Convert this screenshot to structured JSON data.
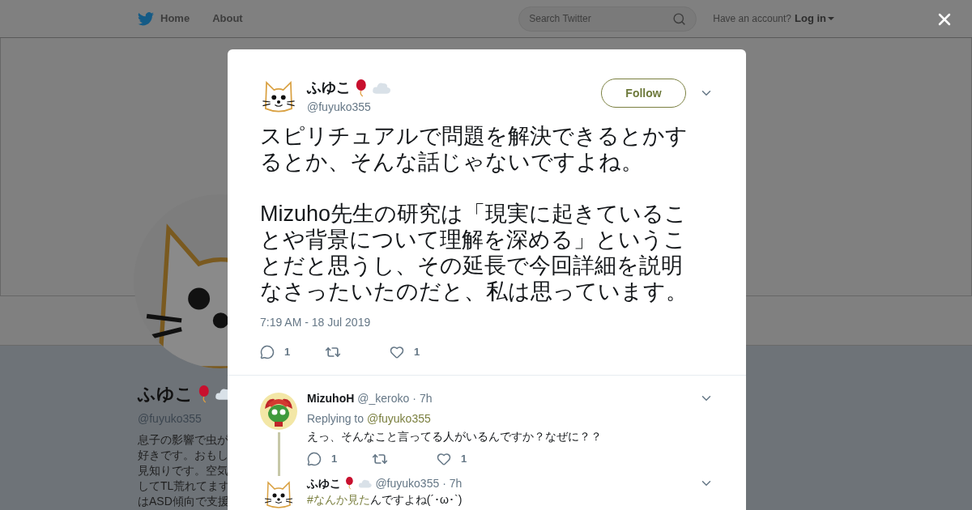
{
  "header": {
    "nav": [
      {
        "label": "Home"
      },
      {
        "label": "About"
      }
    ],
    "search": {
      "placeholder": "Search Twitter"
    },
    "account": {
      "prompt": "Have an account?",
      "login": "Log in"
    }
  },
  "profile": {
    "name": "ふゆこ",
    "handle": "@fuyuko355",
    "bio_lines": [
      "息子の影響で虫が",
      "好きです。おもし",
      "見知りです。空気",
      "してTL荒れてます",
      "はASD傾向で支援"
    ]
  },
  "tweet": {
    "name": "ふゆこ",
    "handle": "@fuyuko355",
    "follow": "Follow",
    "paragraphs": [
      "スピリチュアルで問題を解決できるとかするとか、そんな話じゃないですよね。",
      "Mizuho先生の研究は「現実に起きていることや背景について理解を深める」ということだと思うし、その延長で今回詳細を説明なさったいたのだと、私は思っています。"
    ],
    "timestamp": "7:19 AM - 18 Jul 2019",
    "reply_count": "1",
    "like_count": "1"
  },
  "replies": [
    {
      "kind": "frog",
      "name": "MizuhoH",
      "emoji": false,
      "handle": "@_keroko",
      "time": "· 7h",
      "replying_label": "Replying to",
      "replying_to": "@fuyuko355",
      "text": "えっ、そんなこと言ってる人がいるんですか？なぜに？？",
      "reply_count": "1",
      "like_count": "1",
      "thread_line": true
    },
    {
      "kind": "cat",
      "name": "ふゆこ",
      "emoji": true,
      "handle": "@fuyuko355",
      "time": "· 7h",
      "hashtag": "#なんか見た",
      "text": "んですよね(´･ω･`)",
      "thread_line": false
    }
  ]
}
